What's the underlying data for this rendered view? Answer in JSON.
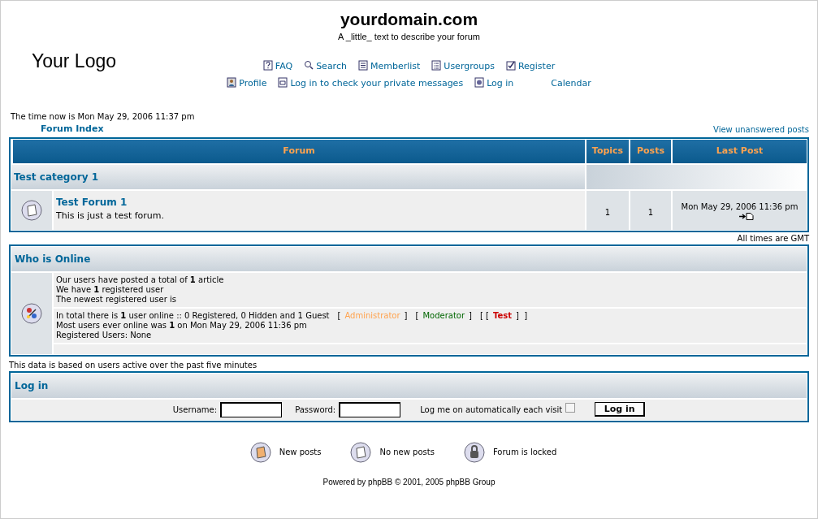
{
  "header": {
    "site_name": "yourdomain.com",
    "description": "A _little_ text to describe your forum",
    "logo": "Your Logo"
  },
  "nav_row1": [
    {
      "label": "FAQ",
      "kind": "faq"
    },
    {
      "label": "Search",
      "kind": "search"
    },
    {
      "label": "Memberlist",
      "kind": "list"
    },
    {
      "label": "Usergroups",
      "kind": "groups"
    },
    {
      "label": "Register",
      "kind": "check"
    }
  ],
  "nav_row2": [
    {
      "label": "Profile",
      "kind": "profile"
    },
    {
      "label": "Log in to check your private messages",
      "kind": "message"
    },
    {
      "label": "Log in",
      "kind": "login"
    },
    {
      "label": "Calendar",
      "kind": "plain"
    }
  ],
  "time_now": "The time now is Mon May 29, 2006 11:37 pm",
  "breadcrumb": "Forum Index",
  "unanswered_link": "View unanswered posts",
  "forum_table": {
    "columns": [
      "Forum",
      "Topics",
      "Posts",
      "Last Post"
    ],
    "category": "Test category 1",
    "rows": [
      {
        "title": "Test Forum 1",
        "description": "This is just a test forum.",
        "topics": "1",
        "posts": "1",
        "last_post": "Mon May 29, 2006 11:36 pm"
      }
    ]
  },
  "timezone_note": "All times are GMT",
  "who_is_online": {
    "title": "Who is Online",
    "stats": [
      "Our users have posted a total of **1** article",
      "We have **1** registered user",
      "The newest registered user is"
    ],
    "online_text": "In total there is **1** user online :: 0 Registered, 0 Hidden and 1 Guest",
    "legend": [
      {
        "open": "[",
        "label": "Administrator",
        "close": "]",
        "color": "#ffa34f",
        "bold": false
      },
      {
        "open": "[",
        "label": "Moderator",
        "close": "]",
        "color": "#006600",
        "bold": false
      },
      {
        "open": "[ [",
        "label": "Test",
        "close": "]  ]",
        "color": "#cc0000",
        "bold": true
      }
    ],
    "record_text": "Most users ever online was **1** on Mon May 29, 2006 11:36 pm",
    "registered_users": "Registered Users: None"
  },
  "online_note": "This data is based on users active over the past five minutes",
  "login": {
    "title": "Log in",
    "username_label": "Username:",
    "password_label": "Password:",
    "auto_login_label": "Log me on automatically each visit",
    "auto_login_checked": false,
    "button": "Log in"
  },
  "legend_icons": [
    {
      "label": "New posts",
      "kind": "new"
    },
    {
      "label": "No new posts",
      "kind": "none"
    },
    {
      "label": "Forum is locked",
      "kind": "locked"
    }
  ],
  "footer": "Powered by phpBB © 2001, 2005 phpBB Group"
}
